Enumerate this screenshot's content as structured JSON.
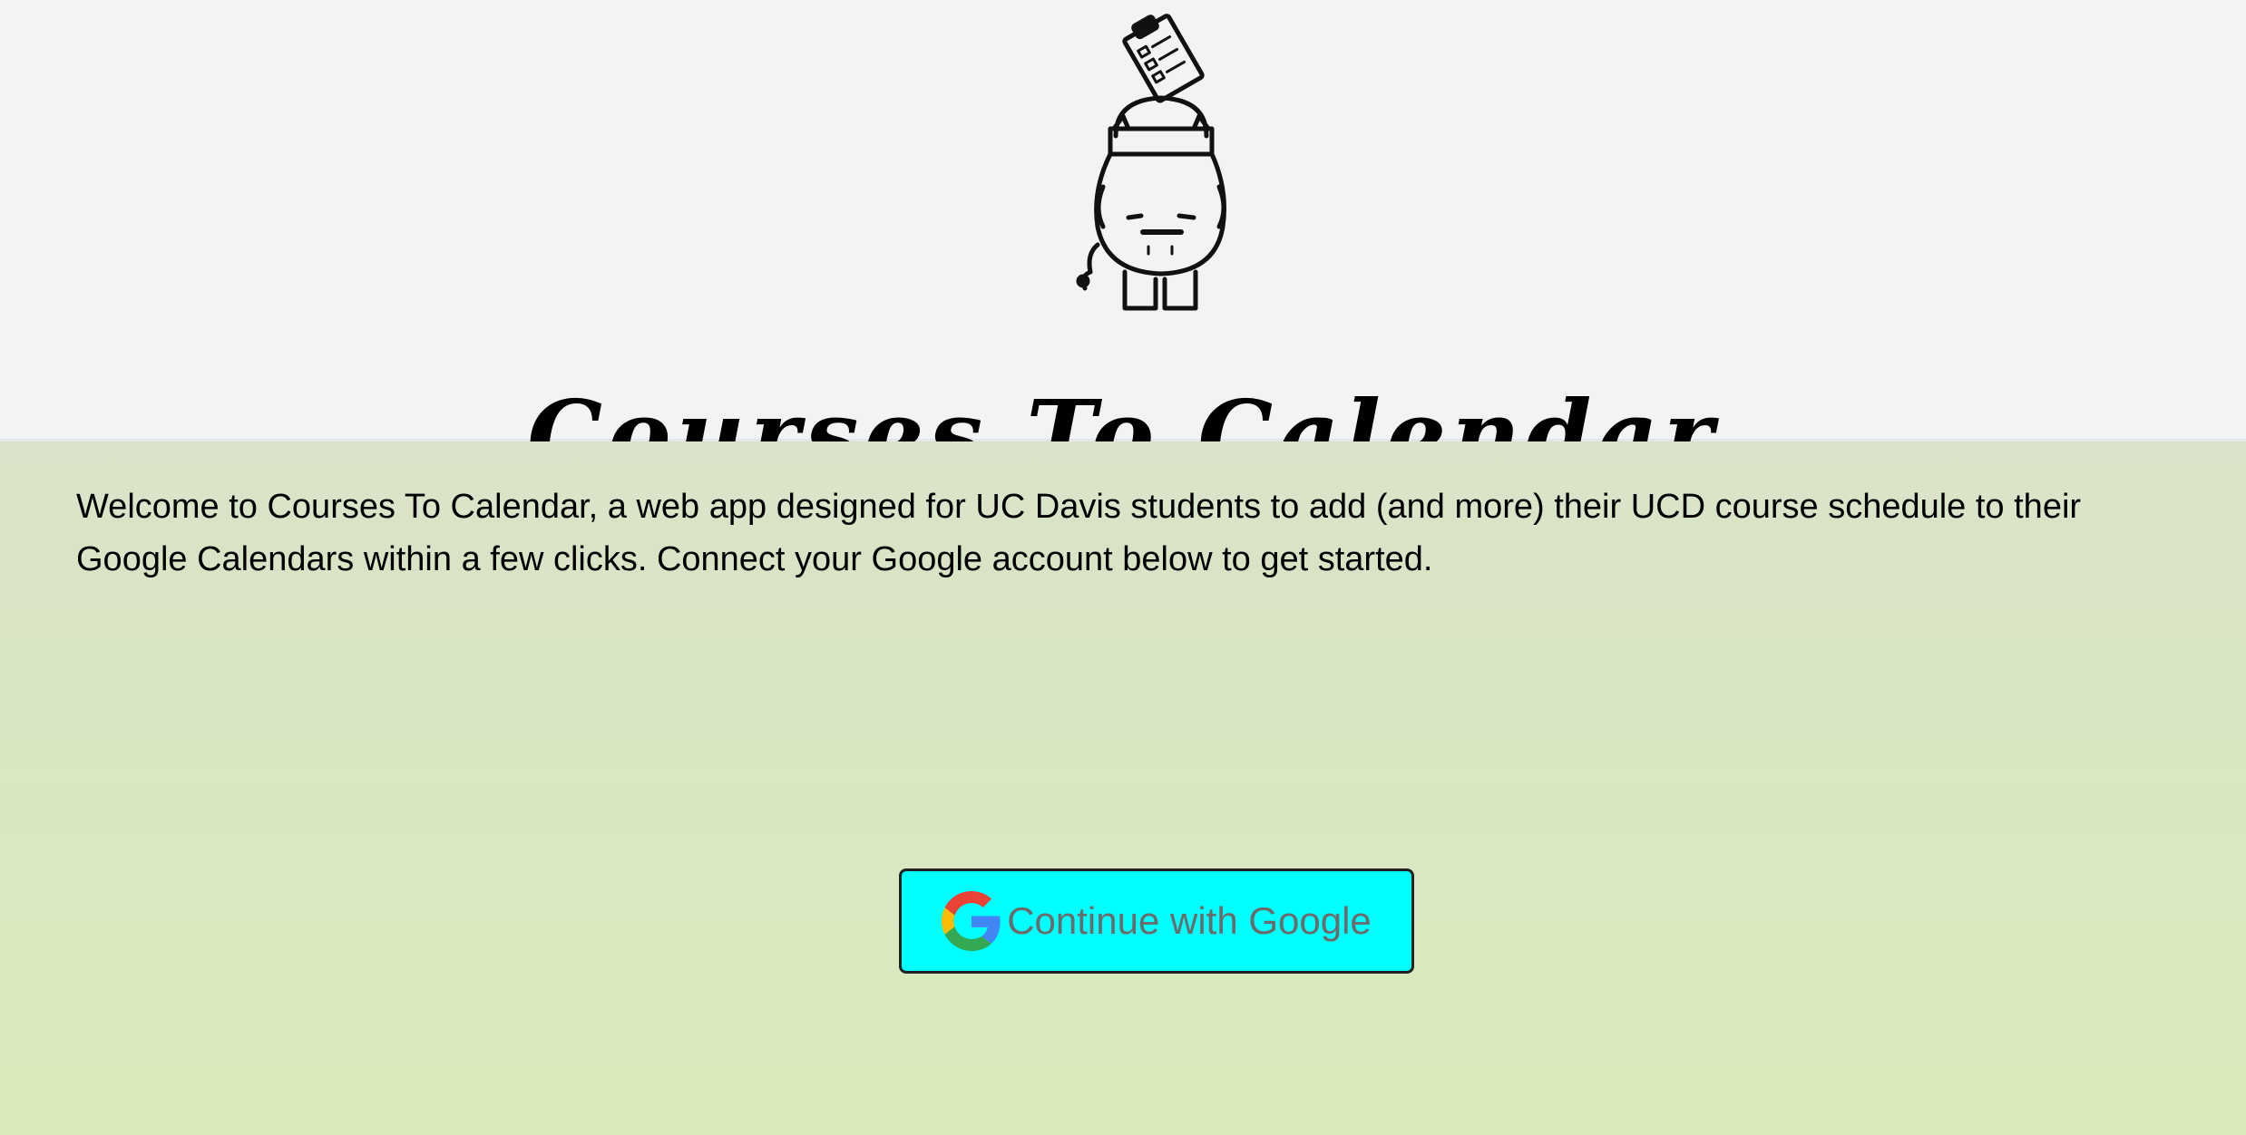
{
  "header": {
    "title": "Courses To Calendar",
    "logo": "clipboard-robot-mascot"
  },
  "main": {
    "intro": "Welcome to Courses To Calendar, a web app designed for UC Davis students to add (and more) their UCD course schedule to their Google Calendars within a few clicks. Connect your Google account below to get started."
  },
  "login": {
    "button_label": "Continue with Google",
    "icon": "google-g-icon",
    "button_color": "#00ffff",
    "label_color": "#6b6b6b"
  },
  "colors": {
    "header_bg": "#f2f3f5",
    "gradient_top": "#d9e3c9",
    "gradient_bottom": "#d9ebba"
  }
}
